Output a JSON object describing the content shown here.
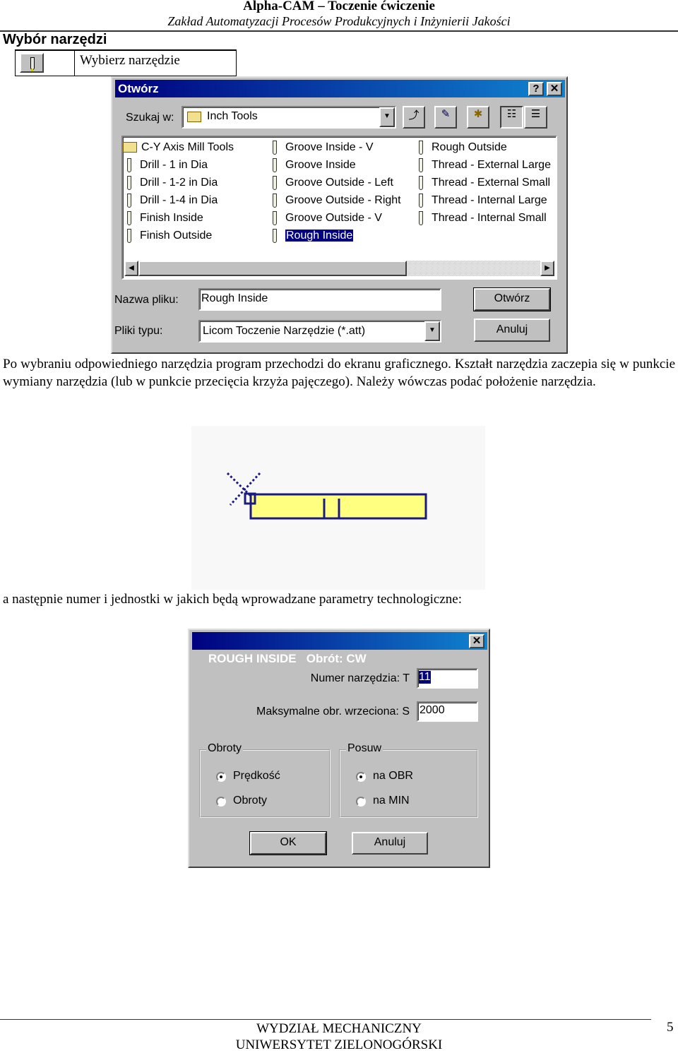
{
  "header": {
    "title": "Alpha-CAM – Toczenie ćwiczenie",
    "subtitle": "Zakład Automatyzacji Procesów Produkcyjnych i Inżynierii Jakości"
  },
  "section": {
    "title": "Wybór narzędzi",
    "table": {
      "icon": "tool-icon",
      "label": "Wybierz narzędzie"
    }
  },
  "open_dialog": {
    "title": "Otwórz",
    "help": "?",
    "close": "✕",
    "look_in_label": "Szukaj w:",
    "look_in_value": "Inch Tools",
    "toolbar_icons": [
      "up-folder-icon",
      "desktop-icon",
      "new-folder-icon",
      "list-view-icon",
      "details-view-icon"
    ],
    "files": [
      {
        "name": "C-Y Axis Mill Tools",
        "type": "folder"
      },
      {
        "name": "Drill -  1 in Dia",
        "type": "tool"
      },
      {
        "name": "Drill -  1-2 in Dia",
        "type": "tool"
      },
      {
        "name": "Drill -  1-4 in Dia",
        "type": "tool"
      },
      {
        "name": "Finish Inside",
        "type": "tool"
      },
      {
        "name": "Finish Outside",
        "type": "tool"
      },
      {
        "name": "Groove  Inside - V",
        "type": "tool"
      },
      {
        "name": "Groove Inside",
        "type": "tool"
      },
      {
        "name": "Groove Outside - Left",
        "type": "tool"
      },
      {
        "name": "Groove Outside - Right",
        "type": "tool"
      },
      {
        "name": "Groove Outside - V",
        "type": "tool"
      },
      {
        "name": "Rough Inside",
        "type": "tool",
        "selected": true
      },
      {
        "name": "Rough Outside",
        "type": "tool"
      },
      {
        "name": "Thread - External Large",
        "type": "tool"
      },
      {
        "name": "Thread - External Small",
        "type": "tool"
      },
      {
        "name": "Thread - Internal Large",
        "type": "tool"
      },
      {
        "name": "Thread - Internal Small",
        "type": "tool"
      }
    ],
    "filename_label": "Nazwa pliku:",
    "filename_value": "Rough Inside",
    "filetype_label": "Pliki typu:",
    "filetype_value": "Licom Toczenie Narzędzie (*.att)",
    "open_button": "Otwórz",
    "cancel_button": "Anuluj"
  },
  "body": {
    "paragraph": "Po wybraniu odpowiedniego narzędzia program przechodzi do ekranu graficznego. Kształt narzędzia zaczepia się w punkcie wymiany narzędzia (lub w punkcie przecięcia krzyża pajęczego). Należy wówczas podać położenie narzędzia.",
    "line2": "a następnie numer i jednostki w jakich będą wprowadzane parametry technologiczne:"
  },
  "figure": {
    "tool_fill": "#ffff80",
    "tool_stroke": "#1a1a80"
  },
  "tool_dialog": {
    "title": "ROUGH INSIDE   Obrót: CW",
    "close": "✕",
    "tool_number_label": "Numer narzędzia: T",
    "tool_number_value": "11",
    "max_speed_label": "Maksymalne obr. wrzeciona: S",
    "max_speed_value": "2000",
    "group_speed": {
      "label": "Obroty",
      "options": [
        "Prędkość",
        "Obroty"
      ],
      "selected": 0
    },
    "group_feed": {
      "label": "Posuw",
      "options": [
        "na OBR",
        "na MIN"
      ],
      "selected": 0
    },
    "ok_button": "OK",
    "cancel_button": "Anuluj"
  },
  "footer": {
    "line1": "WYDZIAŁ MECHANICZNY",
    "line2": "UNIWERSYTET ZIELONOGÓRSKI",
    "page": "5"
  }
}
